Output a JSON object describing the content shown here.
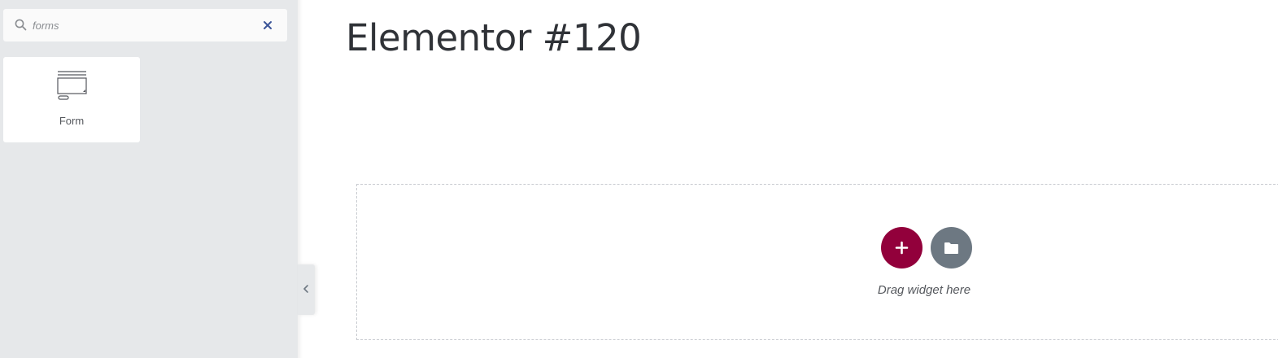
{
  "panel": {
    "search": {
      "value": "forms",
      "icon": "search-icon",
      "clear_icon": "close-icon"
    },
    "widgets": [
      {
        "label": "Form",
        "icon": "form-icon"
      }
    ],
    "collapse_icon": "chevron-left-icon"
  },
  "canvas": {
    "title": "Elementor #120",
    "drop_hint": "Drag widget here",
    "add_section_icon": "plus-icon",
    "add_template_icon": "folder-icon"
  },
  "colors": {
    "panel_bg": "#e6e8ea",
    "accent": "#92003b",
    "template_button": "#6d7882",
    "title_text": "#2f3237"
  }
}
